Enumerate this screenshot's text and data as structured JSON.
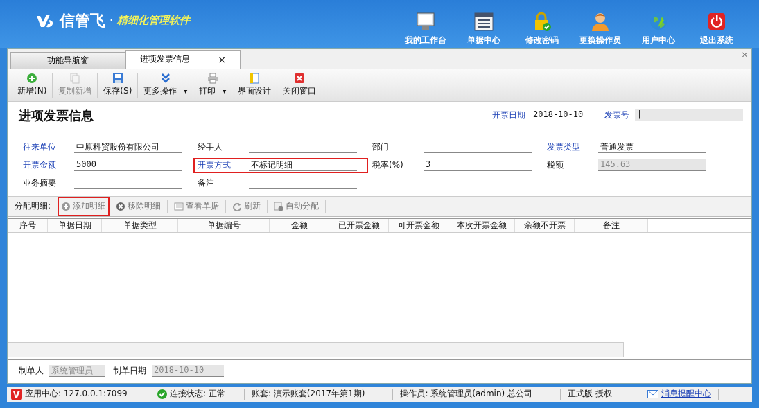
{
  "header": {
    "brand": "信管飞",
    "separator": "·",
    "tagline": "精细化管理软件",
    "nav": [
      {
        "label": "我的工作台",
        "kind": "monitor"
      },
      {
        "label": "单据中心",
        "kind": "list"
      },
      {
        "label": "修改密码",
        "kind": "lock"
      },
      {
        "label": "更换操作员",
        "kind": "user"
      },
      {
        "label": "用户中心",
        "kind": "globe"
      },
      {
        "label": "退出系统",
        "kind": "power"
      }
    ]
  },
  "tabs": [
    {
      "label": "功能导航窗",
      "selected": false
    },
    {
      "label": "进项发票信息",
      "selected": true,
      "close": "×"
    }
  ],
  "tabs_close": "×",
  "toolbar": [
    {
      "label": "新增(N)",
      "kind": "add",
      "disabled": false
    },
    {
      "label": "复制新增",
      "kind": "copy",
      "disabled": true
    },
    {
      "label": "保存(S)",
      "kind": "save",
      "disabled": false
    },
    {
      "label": "更多操作",
      "kind": "more",
      "disabled": false,
      "caret": "▾"
    },
    {
      "label": "打印",
      "kind": "print",
      "disabled": false,
      "caret": "▾"
    },
    {
      "label": "界面设计",
      "kind": "design",
      "disabled": false
    },
    {
      "label": "关闭窗口",
      "kind": "close",
      "disabled": false
    }
  ],
  "form": {
    "title": "进项发票信息",
    "header_fields": [
      {
        "label": "开票日期",
        "value": "2018-10-10",
        "link": true
      },
      {
        "label": "发票号",
        "value": "|",
        "link": true
      }
    ],
    "rows": [
      [
        {
          "label": "往来单位",
          "value": "中原科贸股份有限公司",
          "link": true,
          "disabled": false,
          "highlighted": false
        },
        {
          "label": "经手人",
          "link": false,
          "disabled": false,
          "highlighted": false
        },
        {
          "label": "部门",
          "link": false,
          "disabled": false,
          "highlighted": false
        },
        {
          "label": "发票类型",
          "value": "普通发票",
          "link": true,
          "disabled": false,
          "highlighted": false
        }
      ],
      [
        {
          "label": "开票金额",
          "value": "5000",
          "link": true,
          "disabled": false,
          "highlighted": false
        },
        {
          "label": "开票方式",
          "value": "不标记明细",
          "link": true,
          "disabled": false,
          "highlighted": true
        },
        {
          "label": "税率(%)",
          "value": "3",
          "link": false,
          "disabled": false,
          "highlighted": false
        },
        {
          "label": "税额",
          "value": "145.63",
          "link": false,
          "disabled": true,
          "highlighted": false
        }
      ],
      [
        {
          "label": "业务摘要",
          "link": false,
          "disabled": false,
          "highlighted": false
        },
        {
          "label": "备注",
          "link": false,
          "disabled": false,
          "highlighted": false
        }
      ]
    ]
  },
  "detail": {
    "label": "分配明细:",
    "buttons": [
      {
        "label": "添加明细",
        "kind": "add",
        "highlighted": true
      },
      {
        "label": "移除明细",
        "kind": "remove",
        "highlighted": false
      },
      {
        "label": "查看单据",
        "kind": "view",
        "highlighted": false
      },
      {
        "label": "刷新",
        "kind": "refresh",
        "highlighted": false
      },
      {
        "label": "自动分配",
        "kind": "auto",
        "highlighted": false
      }
    ],
    "columns": [
      "序号",
      "单据日期",
      "单据类型",
      "单据编号",
      "金额",
      "已开票金额",
      "可开票金额",
      "本次开票金额",
      "余额不开票",
      "备注"
    ]
  },
  "footer": [
    {
      "label": "制单人",
      "value": "系统管理员"
    },
    {
      "label": "制单日期",
      "value": "2018-10-10"
    }
  ],
  "status_bar": [
    {
      "text": "应用中心: 127.0.0.1:7099",
      "kind": "app"
    },
    {
      "text": "连接状态: 正常",
      "kind": "ok"
    },
    {
      "text": "账套: 演示账套(2017年第1期)",
      "kind": "plain"
    },
    {
      "text": "操作员: 系统管理员(admin) 总公司",
      "kind": "plain"
    },
    {
      "text": "正式版 授权",
      "kind": "plain"
    },
    {
      "text": "消息提醒中心",
      "kind": "mail"
    }
  ]
}
